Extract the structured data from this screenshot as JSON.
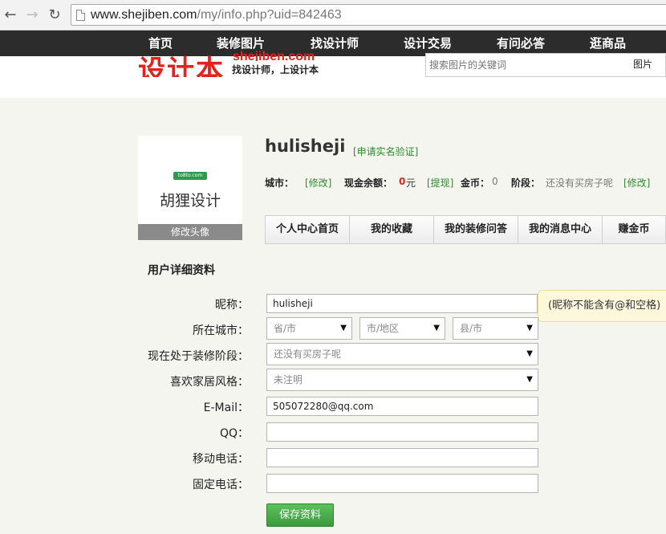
{
  "browser": {
    "url_host": "www.shejiben.com",
    "url_path": "/my/info.php?uid=842463"
  },
  "topnav": {
    "items": [
      "首页",
      "装修图片",
      "找设计师",
      "设计交易",
      "有问必答",
      "逛商品"
    ]
  },
  "header": {
    "logo_text": "设计本",
    "logo_domain": "shejiben.com",
    "slogan": "找设计师，上设计本",
    "search_placeholder": "搜索图片的关键词",
    "search_button": "图片"
  },
  "profile": {
    "avatar_tag": "to8to.com",
    "avatar_name": "胡狸设计",
    "avatar_edit": "修改头像",
    "username": "hulisheji",
    "verify_link": "[申请实名验证]",
    "city_label": "城市：",
    "city_edit": "[修改]",
    "balance_label": "现金余额：",
    "balance_value": "0",
    "balance_unit": "元",
    "withdraw_link": "[提现]",
    "coins_label": "金币：",
    "coins_value": "0",
    "stage_label": "阶段：",
    "stage_value": "还没有买房子呢",
    "stage_edit": "[修改]"
  },
  "tabs": [
    "个人中心首页",
    "我的收藏",
    "我的装修问答",
    "我的消息中心",
    "赚金币"
  ],
  "form": {
    "title": "用户详细资料",
    "nickname_label": "昵称：",
    "nickname_value": "hulisheji",
    "nickname_tip": "(昵称不能含有@和空格)",
    "city_label": "所在城市：",
    "province_value": "省/市",
    "city_value": "市/地区",
    "county_value": "县/市",
    "stage_label": "现在处于装修阶段：",
    "stage_value": "还没有买房子呢",
    "style_label": "喜欢家居风格：",
    "style_value": "未注明",
    "email_label": "E-Mail：",
    "email_value": "505072280@qq.com",
    "qq_label": "QQ：",
    "qq_value": "",
    "mobile_label": "移动电话：",
    "mobile_value": "",
    "phone_label": "固定电话：",
    "phone_value": "",
    "save_button": "保存资料"
  },
  "colors": {
    "nav_bg": "#2c2c2c",
    "brand_red": "#e3231b",
    "link_green": "#2e8b2e",
    "button_green": "#4cae4c",
    "tooltip_bg": "#fdf8dc"
  }
}
